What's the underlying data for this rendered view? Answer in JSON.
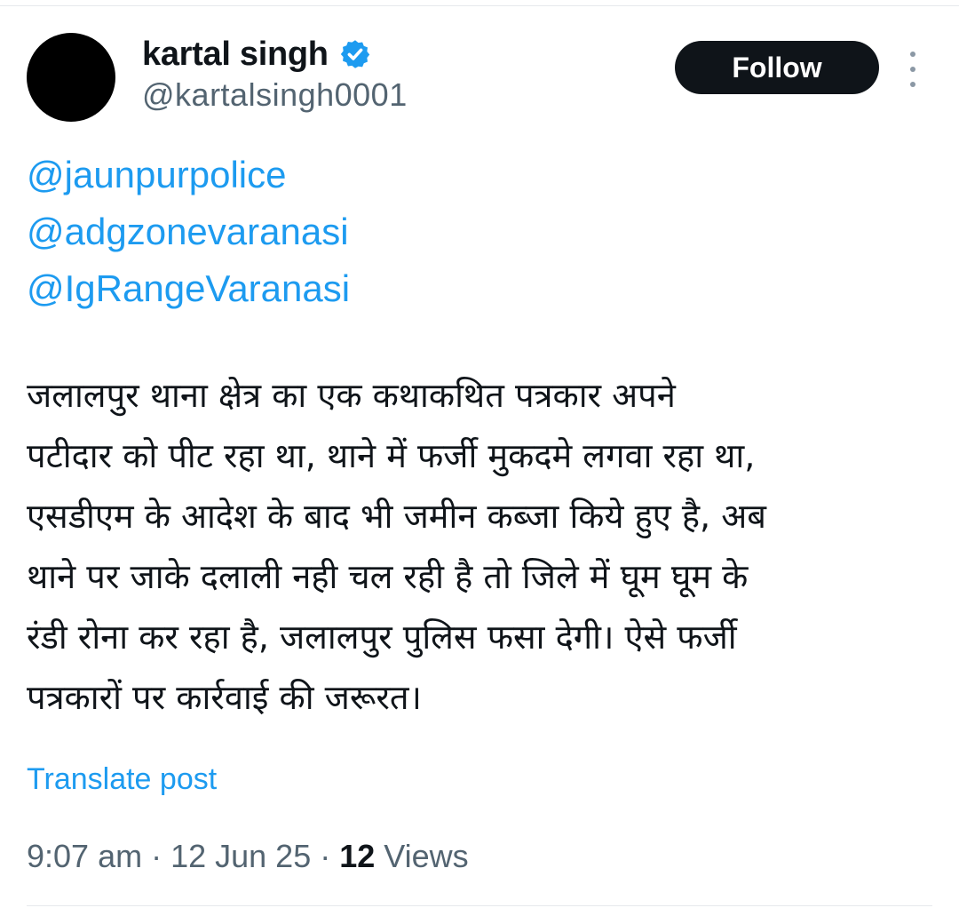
{
  "author": {
    "display_name": "kartal singh",
    "handle": "@kartalsingh0001",
    "verified_icon": "verified-badge-icon",
    "avatar_color": "#000000"
  },
  "actions": {
    "follow_label": "Follow",
    "more_icon": "more-vertical-icon"
  },
  "tweet": {
    "mentions": [
      "@jaunpurpolice",
      "@adgzonevaranasi",
      "@IgRangeVaranasi"
    ],
    "lines": [
      "जलालपुर थाना क्षेत्र का एक कथाकथित पत्रकार अपने",
      "पटीदार को पीट रहा था, थाने में फर्जी मुकदमे लगवा रहा था,",
      "एसडीएम के आदेश के बाद भी जमीन कब्जा किये हुए है, अब",
      "थाने पर जाके दलाली नही चल रही है तो जिले में घूम घूम के",
      "रंडी रोना कर रहा है, जलालपुर पुलिस फसा देगी। ऐसे फर्जी",
      "पत्रकारों पर कार्रवाई की जरूरत।"
    ],
    "translate_label": "Translate post"
  },
  "meta": {
    "time": "9:07 am",
    "separator": " · ",
    "date": "12 Jun 25",
    "views_count": "12",
    "views_label": "Views"
  },
  "colors": {
    "link": "#1d9bf0",
    "text": "#0f1419",
    "secondary": "#536471",
    "button_bg": "#0f1419"
  }
}
